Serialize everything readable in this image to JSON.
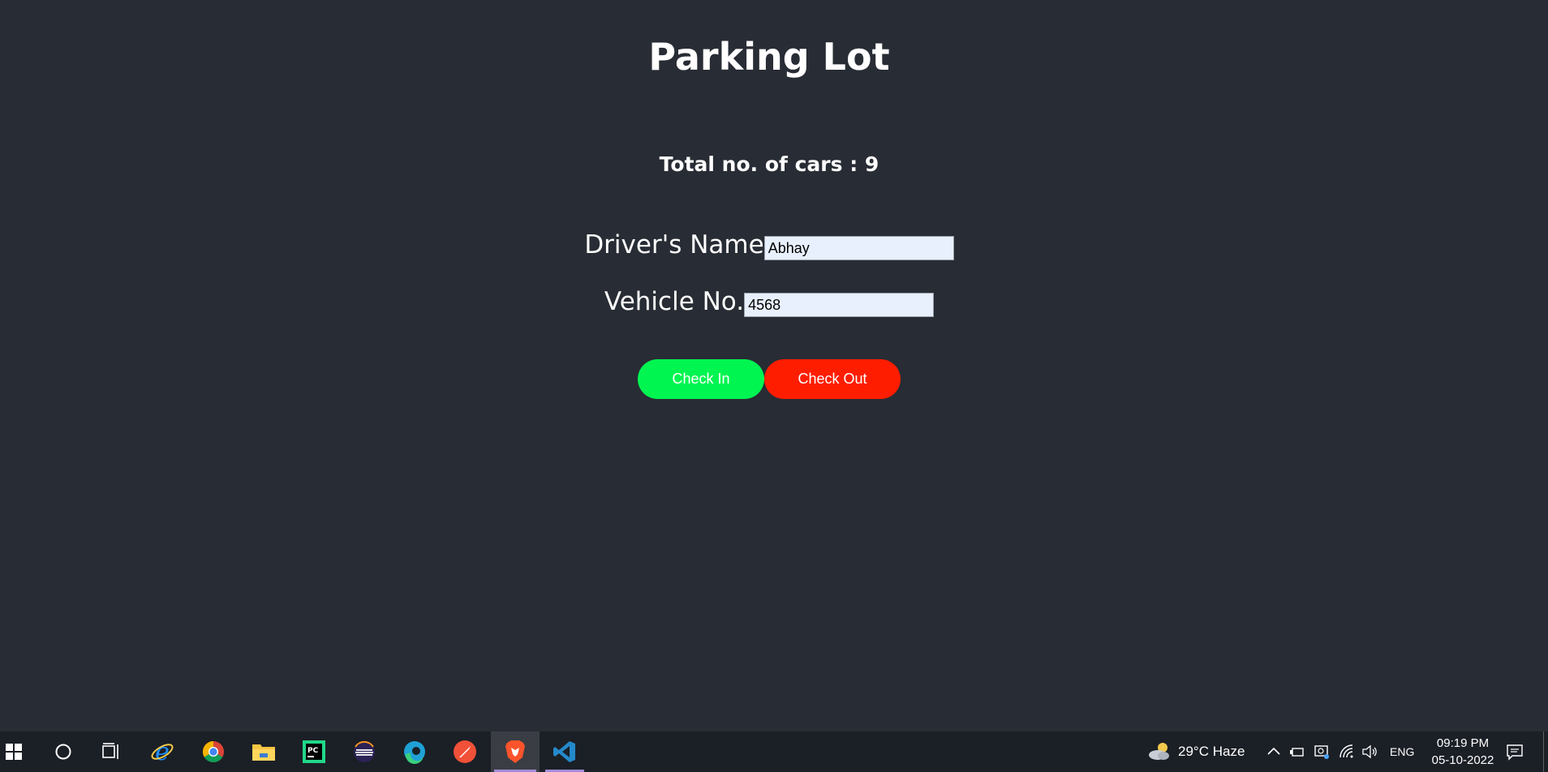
{
  "app": {
    "title": "Parking Lot",
    "total_label": "Total no. of cars : 9"
  },
  "form": {
    "driver_label": "Driver's Name",
    "driver_value": "Abhay",
    "vehicle_label": "Vehicle No.",
    "vehicle_value": "4568"
  },
  "buttons": {
    "check_in": "Check In",
    "check_out": "Check Out"
  },
  "colors": {
    "background": "#282c34",
    "check_in": "#00f551",
    "check_out": "#ff1d00",
    "input_bg": "#e8f0fe"
  },
  "taskbar": {
    "apps": [
      "start-icon",
      "search-icon",
      "task-view-icon",
      "internet-explorer-icon",
      "chrome-icon",
      "file-explorer-icon",
      "pycharm-icon",
      "eclipse-icon",
      "edge-icon",
      "swift-icon",
      "brave-icon",
      "vscode-icon"
    ],
    "weather": "29°C  Haze",
    "language": "ENG",
    "time": "09:19 PM",
    "date": "05-10-2022"
  }
}
